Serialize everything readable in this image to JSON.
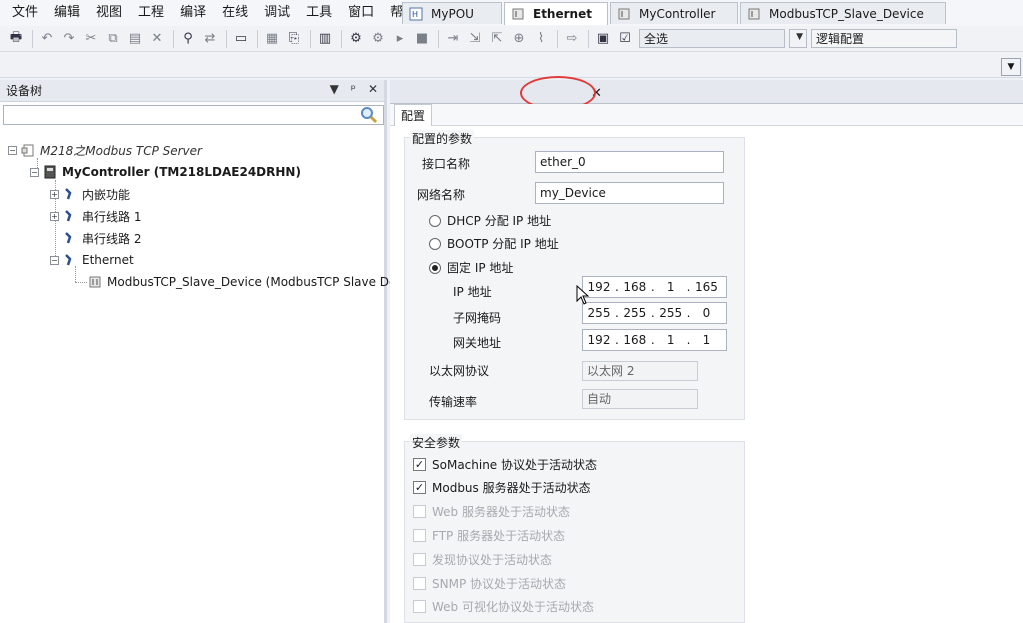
{
  "menu": [
    "文件",
    "编辑",
    "视图",
    "工程",
    "编译",
    "在线",
    "调试",
    "工具",
    "窗口",
    "帮助"
  ],
  "toolbar": {
    "combo_select": "全选",
    "combo_logic": "逻辑配置"
  },
  "device_tree": {
    "title": "设备树",
    "search_placeholder": "",
    "root": "M218之Modbus TCP Server",
    "controller": "MyController (TM218LDAE24DRHN)",
    "items": [
      {
        "label": "内嵌功能"
      },
      {
        "label": "串行线路 1"
      },
      {
        "label": "串行线路 2"
      },
      {
        "label": "Ethernet"
      },
      {
        "label": "ModbusTCP_Slave_Device (ModbusTCP Slave Device)"
      }
    ]
  },
  "tabs": [
    {
      "label": "MyPOU"
    },
    {
      "label": "Ethernet"
    },
    {
      "label": "MyController"
    },
    {
      "label": "ModbusTCP_Slave_Device"
    }
  ],
  "subtab": "配置",
  "config": {
    "group_title": "配置的参数",
    "interface_label": "接口名称",
    "interface_value": "ether_0",
    "network_label": "网络名称",
    "network_value": "my_Device",
    "radio_dhcp": "DHCP 分配 IP 地址",
    "radio_bootp": "BOOTP 分配 IP 地址",
    "radio_fixed": "固定 IP 地址",
    "ip_label": "IP 地址",
    "ip": [
      "192",
      "168",
      "1",
      "165"
    ],
    "mask_label": "子网掩码",
    "mask": [
      "255",
      "255",
      "255",
      "0"
    ],
    "gateway_label": "网关地址",
    "gateway": [
      "192",
      "168",
      "1",
      "1"
    ],
    "eth_protocol_label": "以太网协议",
    "eth_protocol_value": "以太网 2",
    "speed_label": "传输速率",
    "speed_value": "自动"
  },
  "security": {
    "group_title": "安全参数",
    "items": [
      {
        "label": "SoMachine 协议处于活动状态",
        "checked": true,
        "enabled": true
      },
      {
        "label": "Modbus 服务器处于活动状态",
        "checked": true,
        "enabled": true
      },
      {
        "label": "Web 服务器处于活动状态",
        "checked": false,
        "enabled": false
      },
      {
        "label": "FTP 服务器处于活动状态",
        "checked": false,
        "enabled": false
      },
      {
        "label": "发现协议处于活动状态",
        "checked": false,
        "enabled": false
      },
      {
        "label": "SNMP 协议处于活动状态",
        "checked": false,
        "enabled": false
      },
      {
        "label": "Web 可视化协议处于活动状态",
        "checked": false,
        "enabled": false
      }
    ]
  },
  "colors": {
    "accent_red": "#e03a3a",
    "tree_icon_blue": "#2b4f8c"
  }
}
